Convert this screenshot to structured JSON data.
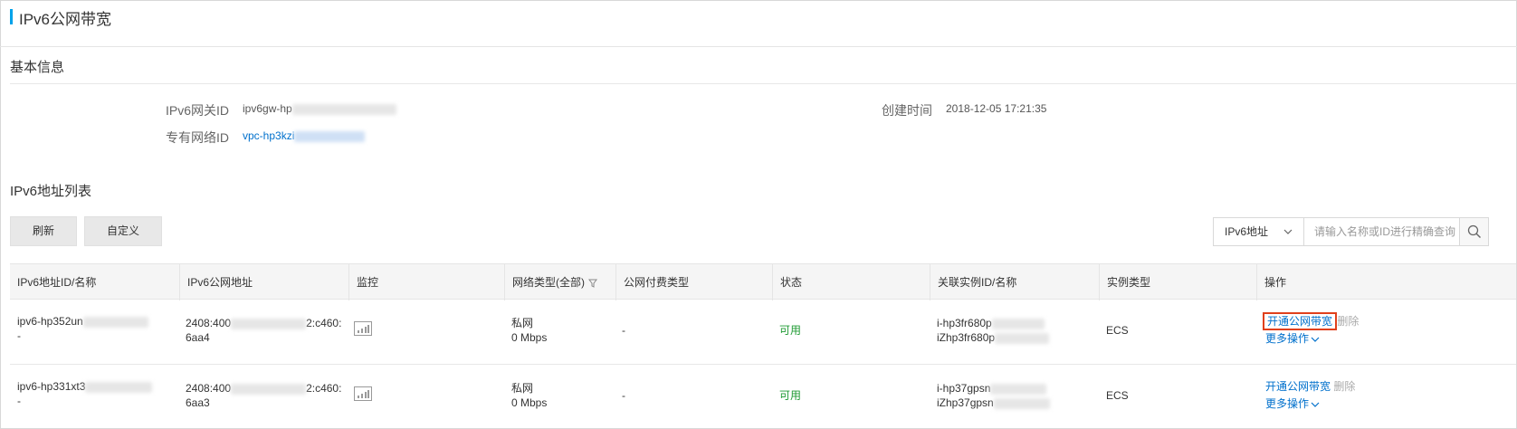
{
  "header": {
    "title": "IPv6公网带宽"
  },
  "basic": {
    "title": "基本信息",
    "gateway_label": "IPv6网关ID",
    "gateway_value": "ipv6gw-hp",
    "vpc_label": "专有网络ID",
    "vpc_value": "vpc-hp3kzi",
    "created_label": "创建时间",
    "created_value": "2018-12-05 17:21:35"
  },
  "list": {
    "title": "IPv6地址列表",
    "refresh_label": "刷新",
    "custom_label": "自定义",
    "search_select": "IPv6地址",
    "search_placeholder": "请输入名称或ID进行精确查询"
  },
  "table": {
    "columns": [
      "IPv6地址ID/名称",
      "IPv6公网地址",
      "监控",
      "网络类型(全部)",
      "公网付费类型",
      "状态",
      "关联实例ID/名称",
      "实例类型",
      "操作"
    ],
    "rows": [
      {
        "id": "ipv6-hp352un",
        "name": "-",
        "addr_prefix": "2408:400",
        "addr_suffix": "2:c460:",
        "addr_line2": "6aa4",
        "net_type": "私网",
        "bandwidth": "0 Mbps",
        "pay_type": "-",
        "status": "可用",
        "instance_id": "i-hp3fr680p",
        "instance_name": "iZhp3fr680p",
        "instance_type": "ECS",
        "op_open": "开通公网带宽",
        "op_delete": "删除",
        "op_more": "更多操作"
      },
      {
        "id": "ipv6-hp331xt3",
        "name": "-",
        "addr_prefix": "2408:400",
        "addr_suffix": "2:c460:",
        "addr_line2": "6aa3",
        "net_type": "私网",
        "bandwidth": "0 Mbps",
        "pay_type": "-",
        "status": "可用",
        "instance_id": "i-hp37gpsn",
        "instance_name": "iZhp37gpsn",
        "instance_type": "ECS",
        "op_open": "开通公网带宽",
        "op_delete": "删除",
        "op_more": "更多操作"
      }
    ]
  },
  "colors": {
    "accent": "#00a2ea",
    "link": "#0070cc",
    "ok": "#1e9a33",
    "highlight": "#e0401c"
  }
}
